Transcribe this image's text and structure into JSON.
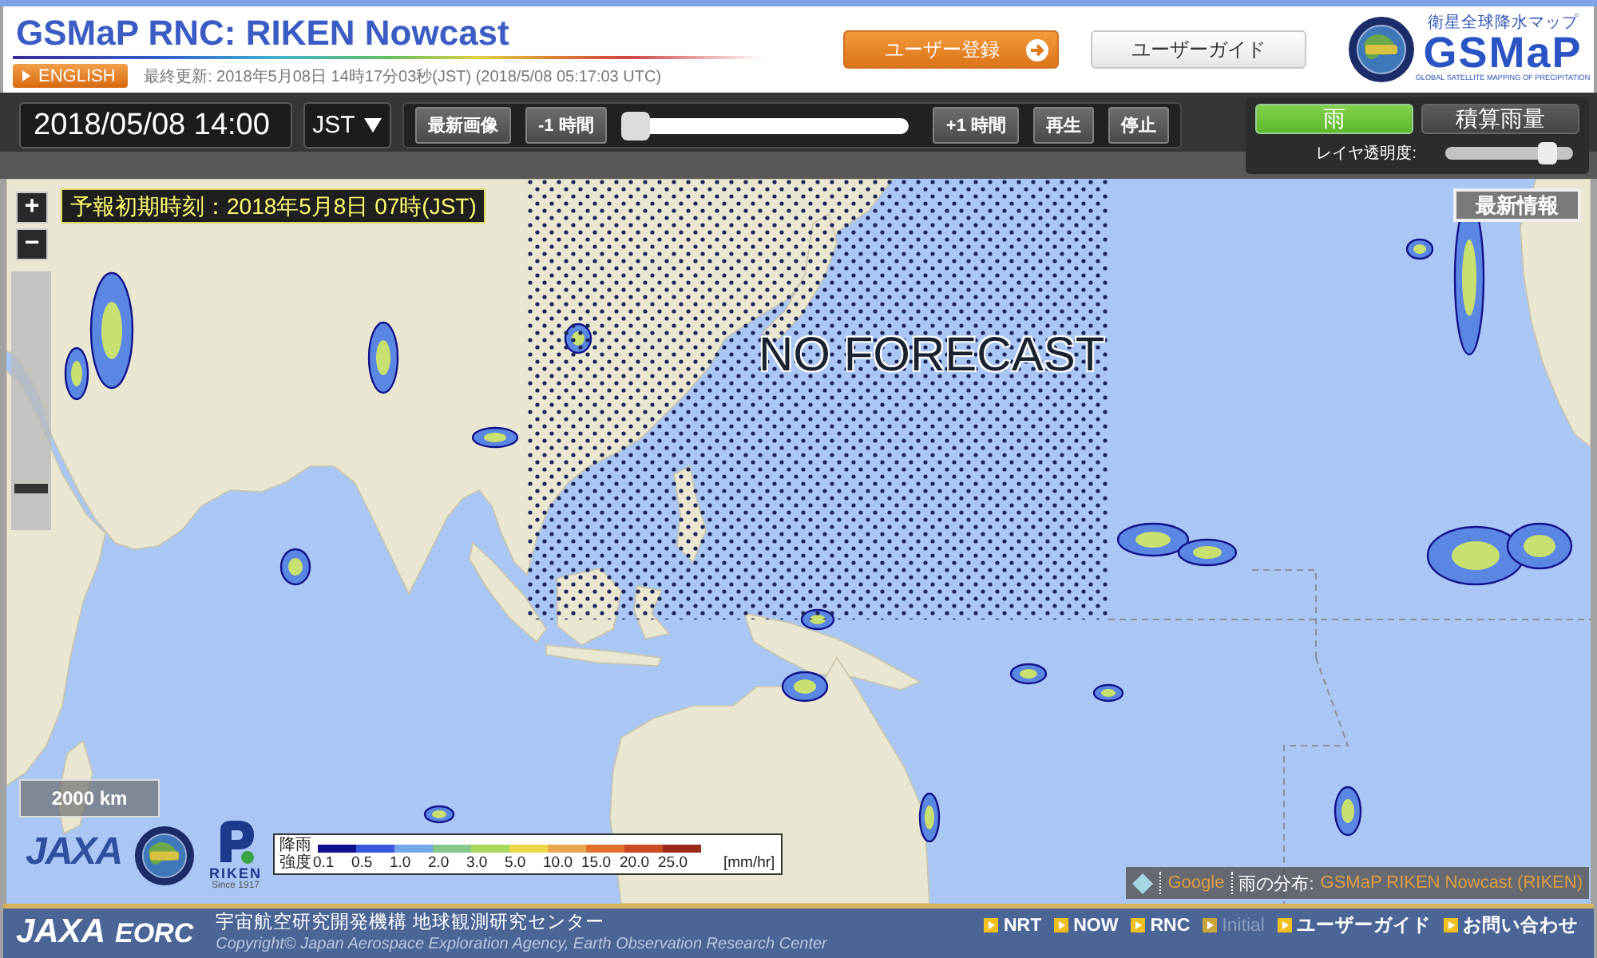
{
  "header": {
    "title": "GSMaP RNC: RIKEN Nowcast",
    "language_button": "ENGLISH",
    "last_updated": "最終更新: 2018年5月08日 14時17分03秒(JST) (2018/5/08 05:17:03 UTC)",
    "buttons": [
      {
        "kind": "primary",
        "label": "ユーザー登録"
      },
      {
        "kind": "secondary",
        "label": "ユーザーガイド"
      }
    ],
    "logo": {
      "tagline": "衛星全球降水マップ",
      "name": "GSMaP",
      "subtitle": "GLOBAL SATELLITE MAPPING OF PRECIPITATION"
    }
  },
  "controls": {
    "datetime": "2018/05/08 14:00",
    "timezone": "JST",
    "player": [
      {
        "kind": "button",
        "label": "最新画像"
      },
      {
        "kind": "button",
        "label": "-1 時間"
      },
      {
        "kind": "slider",
        "level": 0
      },
      {
        "kind": "button",
        "label": "+1 時間"
      },
      {
        "kind": "button",
        "label": "再生"
      },
      {
        "kind": "button",
        "label": "停止"
      }
    ],
    "layers": [
      {
        "label": "雨",
        "selected": true
      },
      {
        "label": "積算雨量",
        "selected": false
      }
    ],
    "opacity": {
      "label": "レイヤ透明度:",
      "level": 0.85
    }
  },
  "map": {
    "zoom_buttons": [
      "+",
      "−"
    ],
    "zoom_slider": {
      "level": 0.15
    },
    "forecast_time": "予報初期時刻：2018年5月8日 07時(JST)",
    "latest_button": "最新情報",
    "no_forecast_label": "NO FORECAST",
    "scale": "2000 km",
    "logos": {
      "jaxa": "JAXA",
      "riken": "RIKEN",
      "riken_since": "Since 1917"
    },
    "legend": {
      "title": [
        "降雨",
        "強度"
      ],
      "steps": [
        {
          "value": "0.1",
          "color": "#10108c"
        },
        {
          "value": "0.5",
          "color": "#3a56dc"
        },
        {
          "value": "1.0",
          "color": "#74a6ea"
        },
        {
          "value": "2.0",
          "color": "#84c88a"
        },
        {
          "value": "3.0",
          "color": "#a8d860"
        },
        {
          "value": "5.0",
          "color": "#ecd848"
        },
        {
          "value": "10.0",
          "color": "#e8a850"
        },
        {
          "value": "15.0",
          "color": "#e07030"
        },
        {
          "value": "20.0",
          "color": "#cc4a22"
        },
        {
          "value": "25.0",
          "color": "#9c2a1a"
        }
      ],
      "unit": "[mm/hr]"
    },
    "attribution": {
      "google": "Google",
      "label": "雨の分布:",
      "source": "GSMaP RIKEN Nowcast (RIKEN)"
    }
  },
  "footer": {
    "logo": "JAXA",
    "unit": "EORC",
    "organization": "宇宙航空研究開発機構 地球観測研究センター",
    "copyright": "Copyright© Japan Aerospace Exploration Agency, Earth Observation Research Center",
    "links": [
      {
        "label": "NRT",
        "disabled": false
      },
      {
        "label": "NOW",
        "disabled": false
      },
      {
        "label": "RNC",
        "disabled": false
      },
      {
        "label": "Initial",
        "disabled": true
      },
      {
        "label": "ユーザーガイド",
        "disabled": false
      },
      {
        "label": "お問い合わせ",
        "disabled": false
      }
    ]
  }
}
